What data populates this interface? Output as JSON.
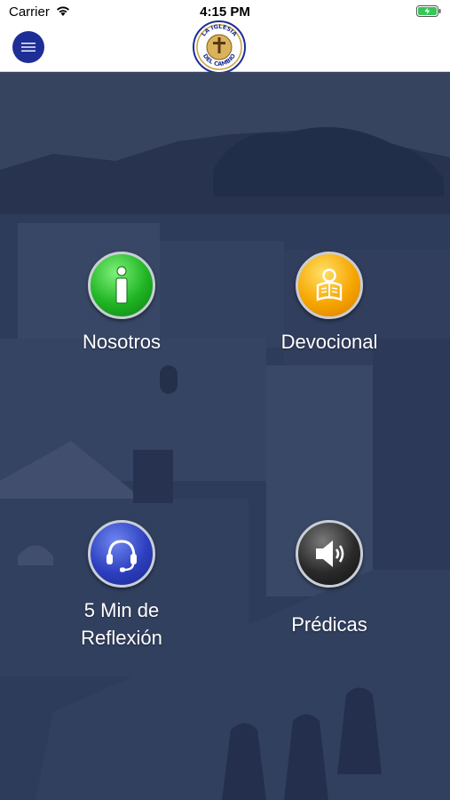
{
  "status_bar": {
    "carrier": "Carrier",
    "time": "4:15 PM"
  },
  "header": {
    "menu_icon": "hamburger-menu-icon",
    "logo": {
      "top_text": "LA IGLESIA",
      "bottom_text": "DEL CAMBIO"
    }
  },
  "tiles": [
    {
      "label": "Nosotros",
      "icon": "info-icon",
      "color": "#1fb423"
    },
    {
      "label": "Devocional",
      "icon": "reading-person-icon",
      "color": "#f7a500"
    },
    {
      "label": "5 Min de Reflexión",
      "icon": "headset-icon",
      "color": "#2d3fbf"
    },
    {
      "label": "Prédicas",
      "icon": "speaker-icon",
      "color": "#2a2a2a"
    }
  ]
}
